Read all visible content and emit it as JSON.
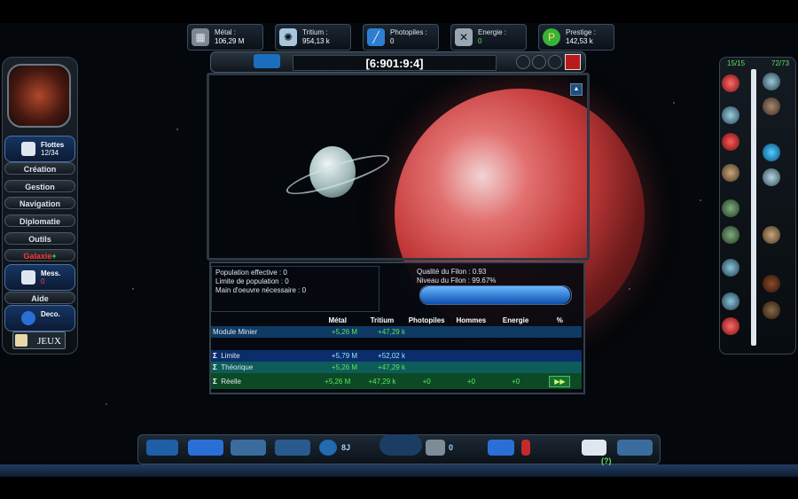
{
  "resources": [
    {
      "label": "Métal :",
      "value": "106,29 M",
      "icon": "metal-icon",
      "color": "#7d8791"
    },
    {
      "label": "Tritium :",
      "value": "954,13 k",
      "icon": "tritium-icon",
      "color": "#a9c6df"
    },
    {
      "label": "Photopiles :",
      "value": "0",
      "icon": "photopile-icon",
      "color": "#2e7fd1"
    },
    {
      "label": "Energie :",
      "value": "0",
      "icon": "energy-icon",
      "color": "#9aa6b2"
    },
    {
      "label": "Prestige :",
      "value": "142,53 k",
      "icon": "prestige-icon",
      "color": "#37b23a"
    }
  ],
  "coordinates": "[6:901:9:4]",
  "sidebar": {
    "fleets_label": "Flottes",
    "fleets_count": "12/34",
    "menu": [
      "Création",
      "Gestion",
      "Navigation",
      "Diplomatie",
      "Outils"
    ],
    "galaxie": "Galaxie",
    "galaxie_plus": "+",
    "messages_label": "Mess.",
    "messages_count": "0",
    "aide": "Aide",
    "deco": "Deco.",
    "jeux": "JEUX"
  },
  "info": {
    "population_effective": "Population effective : 0",
    "limite_population": "Limite de population : 0",
    "main_oeuvre": "Main d'oeuvre nécessaire : 0",
    "qualite_filon": "Qualité du Filon : 0.93",
    "niveau_filon": "Niveau du Filon : 99.67%",
    "filon_level": 0.9967
  },
  "table": {
    "headers": [
      "Métal",
      "Tritium",
      "Photopiles",
      "Hommes",
      "Energie",
      "%"
    ],
    "module": {
      "label": "Module Minier",
      "metal": "+5,26 M",
      "tritium": "+47,29 k"
    },
    "limite": {
      "label": "Limite",
      "metal": "+5,79 M",
      "tritium": "+52,02 k"
    },
    "theorique": {
      "label": "Théorique",
      "metal": "+5,26 M",
      "tritium": "+47,29 k"
    },
    "reelle": {
      "label": "Réelle",
      "metal": "+5,26 M",
      "tritium": "+47,29 k",
      "photopiles": "+0",
      "hommes": "+0",
      "energie": "+0"
    },
    "sigma": "Σ",
    "ff": "▶▶"
  },
  "right_panel": {
    "count_left": "15/15",
    "count_right": "72/73"
  },
  "bottom": {
    "timer": "8J",
    "count": "0",
    "help": "(?)"
  },
  "colors": {
    "accent": "#1b6ebd",
    "green": "#5fe35f",
    "red_planet": "#c43a3a"
  }
}
